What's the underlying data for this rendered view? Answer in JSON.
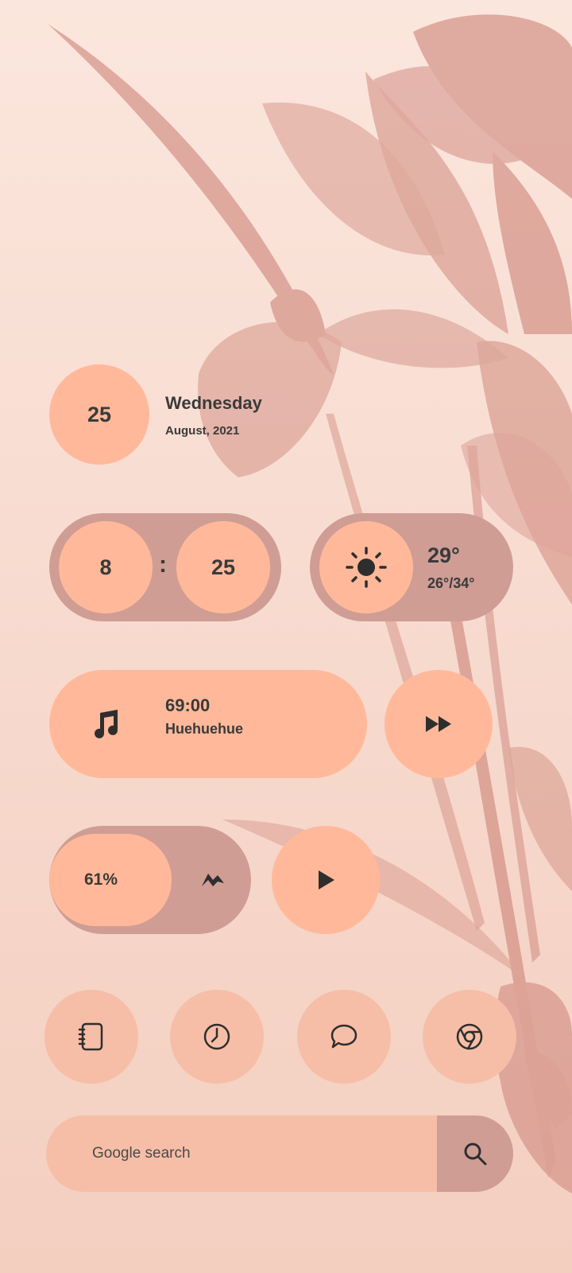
{
  "date_widget": {
    "day_number": "25",
    "weekday": "Wednesday",
    "month_year": "August, 2021"
  },
  "clock_widget": {
    "hour": "8",
    "separator": ":",
    "minute": "25"
  },
  "weather_widget": {
    "icon": "sun-icon",
    "current_temp": "29°",
    "range": "26°/34°"
  },
  "music_widget": {
    "icon": "music-note-icon",
    "time": "69:00",
    "track": "Huehuehue",
    "next_icon": "fast-forward-icon"
  },
  "battery_widget": {
    "percent": "61%",
    "icon": "charging-bolt-icon",
    "play_icon": "play-icon"
  },
  "dock": {
    "apps": [
      "notebook-icon",
      "clock-icon",
      "chat-bubble-icon",
      "chrome-icon"
    ]
  },
  "search": {
    "placeholder": "Google search",
    "icon": "search-icon"
  },
  "colors": {
    "accent": "#ffb99a",
    "muted": "#cf9d94",
    "text": "#3a3a3a",
    "background": "#fbe6dd",
    "flower": "#c97a6f"
  }
}
